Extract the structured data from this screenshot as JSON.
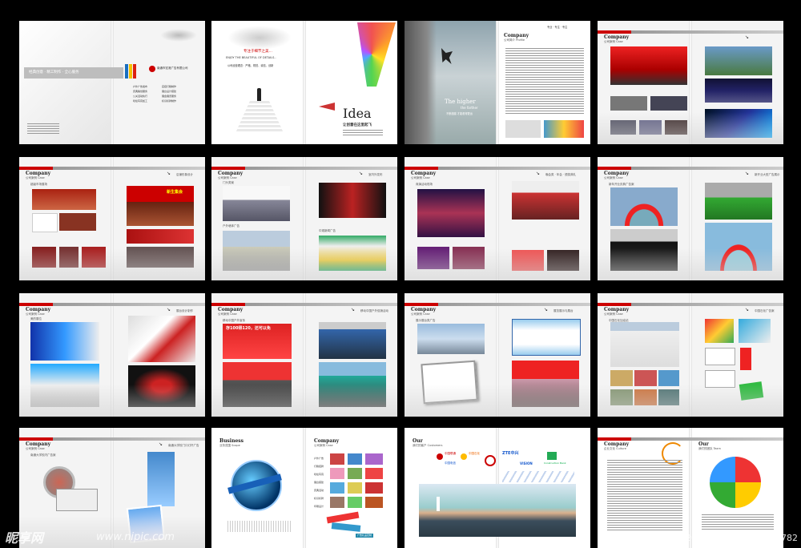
{
  "cover": {
    "slogan": "经典创意 · 精工制作 · 全心服务",
    "company": "南通市宏港广告有限公司",
    "services": [
      "户外广告发布",
      "店招灯箱制作",
      "庆典策划服务",
      "展台设计搭建",
      "公关活动执行",
      "展会展览服务",
      "喷绘写真加工",
      "标识标牌制作"
    ]
  },
  "intro": {
    "line1": "专注于细节之美…",
    "line2": "ENJOY THE BEAUTIFUL OF DETAILS..",
    "line3": "公司经营理念：严格、规范、诚信、创新"
  },
  "idea": {
    "title": "Idea",
    "subtitle": "让创意在这里起飞"
  },
  "profile": {
    "higher": "The higher",
    "farther": "the farther",
    "caption": "不断超越 才能看得更远",
    "company": "Company",
    "heading": "公司简介 Profile",
    "tagline": "专业 · 专注 · 专注"
  },
  "case": {
    "company": "Company",
    "heading": "公司案例 Case"
  },
  "page_labels": {
    "s2_right": "新中都商富案",
    "s5_left": "超级市场展场",
    "s5_right": "店铺形象设计",
    "s6_left": "门头类案",
    "s6_right": "室内外发布",
    "s6_out": "户外墙体广告",
    "s6_bill": "中观新闻广告",
    "s7_left": "商演活动现场",
    "s7_right": "晚会类 · 年会 · 颁奖典礼",
    "s8_left": "新年开业庆典广告案",
    "s8_right": "新开业大型广告展示",
    "s9_left": "美的展位",
    "s9_right": "展台设计制作",
    "s10_left": "移动中国户外宣传",
    "s10_right": "移动中国户外促销活动",
    "s11_left": "展示展台类广告",
    "s11_right": "展览展示与展台",
    "s12_left": "中国石化加油站",
    "s12_right": "中国石化广告案",
    "s13_left": "南通大学校内广告案",
    "s13_right": "南通大学校门口灯杆广告"
  },
  "events": {
    "banner_text": "新生集会",
    "bank_text": "存100得120，还可以免"
  },
  "business": {
    "title": "Business",
    "heading": "业务范围 Scope",
    "company": "Company",
    "case_heading": "公司案例 Case",
    "items": [
      "户外广告",
      "灯箱招牌",
      "喷绘写真",
      "展台搭建",
      "庆典活动",
      "标识标牌",
      "印刷设计"
    ],
    "sign_text": "广告礼品定制"
  },
  "customers": {
    "title": "Our",
    "heading": "我们的客户 Customers",
    "logos": [
      "中国联通",
      "中国石化",
      "中国电信",
      "ZTE中兴",
      "VISION",
      "Construction Bank"
    ]
  },
  "culture": {
    "company": "Company",
    "heading": "企业文化 Culture",
    "team_title": "Our",
    "team_heading": "我们的团队 Team"
  },
  "watermark": {
    "logo": "昵享网",
    "url": "www.nipic.com",
    "id": "ID:6925787 NO:20130625150740000782"
  },
  "colors": {
    "accent_red": "#cc0000",
    "background": "#000000",
    "paper": "#f4f4f4"
  }
}
